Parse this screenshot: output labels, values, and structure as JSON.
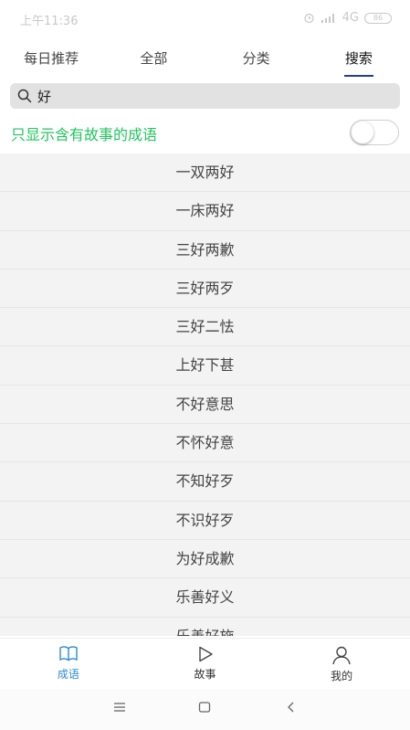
{
  "status": {
    "time": "上午11:36",
    "network": "4G",
    "battery": "86"
  },
  "tabs": [
    {
      "label": "每日推荐",
      "active": false
    },
    {
      "label": "全部",
      "active": false
    },
    {
      "label": "分类",
      "active": false
    },
    {
      "label": "搜索",
      "active": true
    }
  ],
  "search": {
    "value": "好",
    "icon": "search-icon"
  },
  "filter": {
    "label": "只显示含有故事的成语",
    "enabled": false
  },
  "idioms": [
    "一双两好",
    "一床两好",
    "三好两歉",
    "三好两歹",
    "三好二怯",
    "上好下甚",
    "不好意思",
    "不怀好意",
    "不知好歹",
    "不识好歹",
    "为好成歉",
    "乐善好义",
    "乐善好施"
  ],
  "bottom_nav": [
    {
      "label": "成语",
      "icon": "book-icon",
      "active": true
    },
    {
      "label": "故事",
      "icon": "play-icon",
      "active": false
    },
    {
      "label": "我的",
      "icon": "user-icon",
      "active": false
    }
  ],
  "colors": {
    "accent": "#2a8ad4",
    "filter_green": "#22c55e",
    "tab_indicator": "#1f3f8f"
  }
}
